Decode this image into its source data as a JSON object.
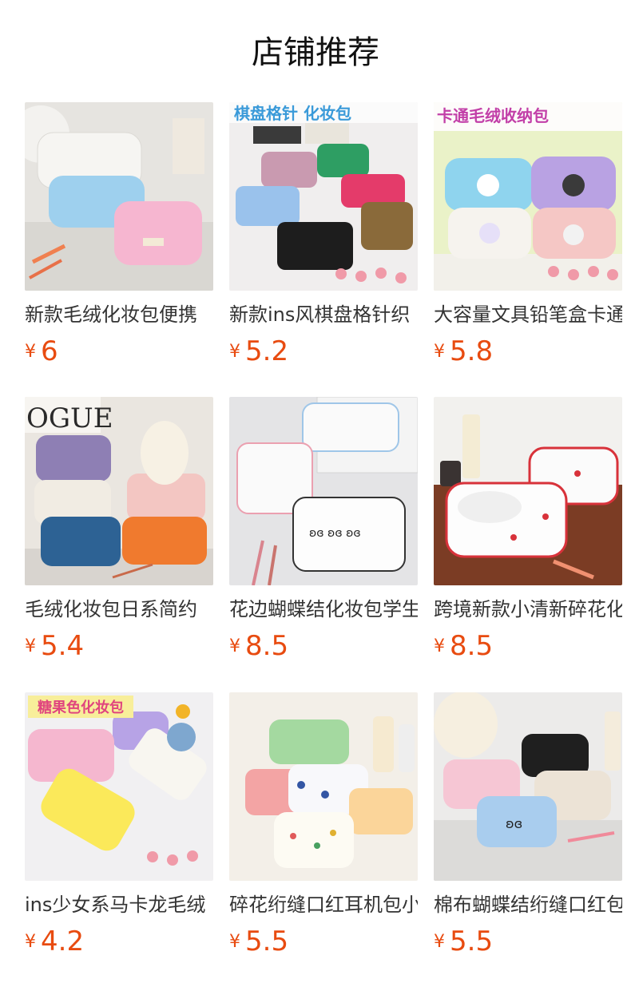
{
  "page": {
    "title": "店铺推荐"
  },
  "currency_symbol": "¥",
  "colors": {
    "price": "#e84b10",
    "title": "#111111",
    "name": "#333333"
  },
  "products": [
    {
      "name": "新款毛绒化妆包便携",
      "price": "6",
      "image": "plush-cosmetic-bags-white-blue-pink",
      "banner": ""
    },
    {
      "name": "新款ins风棋盘格针织",
      "price": "5.2",
      "image": "checkerboard-knit-cosmetic-bags",
      "banner": "棋盘格针 化妆包"
    },
    {
      "name": "大容量文具铅笔盒卡通",
      "price": "5.8",
      "image": "cartoon-plush-pencil-cases",
      "banner": "卡通毛绒收纳包"
    },
    {
      "name": "毛绒化妆包日系简约",
      "price": "5.4",
      "image": "stacked-quilted-plush-bags",
      "banner": ""
    },
    {
      "name": "花边蝴蝶结化妆包学生",
      "price": "8.5",
      "image": "lace-bow-cosmetic-bags",
      "banner": ""
    },
    {
      "name": "跨境新款小清新碎花化",
      "price": "8.5",
      "image": "cherry-print-ruffle-bags",
      "banner": ""
    },
    {
      "name": "ins少女系马卡龙毛绒",
      "price": "4.2",
      "image": "macaron-plush-cosmetic-bags",
      "banner": "糖果色化妆包"
    },
    {
      "name": "碎花绗缝口红耳机包小",
      "price": "5.5",
      "image": "floral-quilted-lipstick-pouches",
      "banner": ""
    },
    {
      "name": "棉布蝴蝶结绗缝口红包",
      "price": "5.5",
      "image": "cotton-bow-quilted-bags",
      "banner": ""
    }
  ]
}
